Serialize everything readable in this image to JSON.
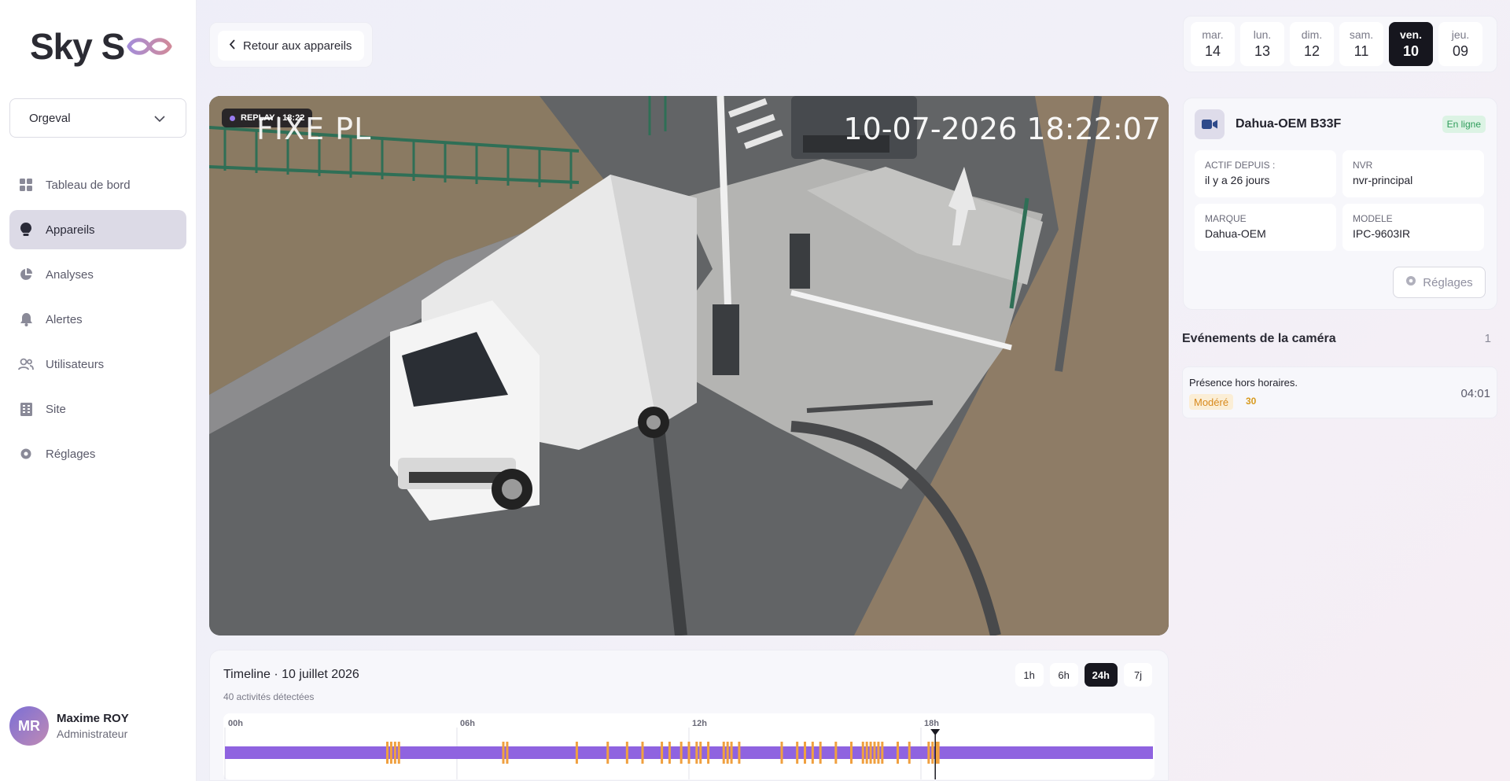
{
  "brand": {
    "logo_text": "Sky S",
    "accent": "#7b6fd6"
  },
  "sidebar": {
    "site_select": "Orgeval",
    "items": [
      {
        "label": "Tableau de bord",
        "icon": "grid-icon",
        "active": false
      },
      {
        "label": "Appareils",
        "icon": "lightbulb-icon",
        "active": true
      },
      {
        "label": "Analyses",
        "icon": "pie-chart-icon",
        "active": false
      },
      {
        "label": "Alertes",
        "icon": "bell-icon",
        "active": false
      },
      {
        "label": "Utilisateurs",
        "icon": "users-icon",
        "active": false
      },
      {
        "label": "Site",
        "icon": "building-icon",
        "active": false
      },
      {
        "label": "Réglages",
        "icon": "gear-icon",
        "active": false
      }
    ],
    "user": {
      "initials": "MR",
      "name": "Maxime ROY",
      "role": "Administrateur"
    }
  },
  "header": {
    "back_label": "Retour aux appareils"
  },
  "video": {
    "replay_badge": "REPLAY · 18:22",
    "camera_overlay_label": "FIXE PL",
    "camera_overlay_time": "10-07-2026 18:22:07"
  },
  "timeline": {
    "title": "Timeline · 10 juillet 2026",
    "subtitle": "40 activités détectées",
    "ranges": [
      "1h",
      "6h",
      "24h",
      "7j"
    ],
    "active_range": "24h",
    "hour_labels": [
      "00h",
      "06h",
      "12h",
      "18h"
    ],
    "cursor_hour": 18.37,
    "event_hours": [
      4.2,
      4.3,
      4.4,
      4.5,
      7.2,
      7.3,
      9.1,
      9.9,
      10.4,
      10.8,
      11.3,
      11.5,
      11.8,
      12.0,
      12.2,
      12.3,
      12.5,
      12.9,
      13.0,
      13.1,
      13.3,
      14.4,
      14.8,
      15.0,
      15.2,
      15.4,
      15.8,
      16.2,
      16.5,
      16.6,
      16.7,
      16.8,
      16.9,
      17.0,
      17.4,
      17.7,
      18.2,
      18.3,
      18.4,
      18.45
    ]
  },
  "days": [
    {
      "name": "mar.",
      "num": "14",
      "active": false
    },
    {
      "name": "lun.",
      "num": "13",
      "active": false
    },
    {
      "name": "dim.",
      "num": "12",
      "active": false
    },
    {
      "name": "sam.",
      "num": "11",
      "active": false
    },
    {
      "name": "ven.",
      "num": "10",
      "active": true
    },
    {
      "name": "jeu.",
      "num": "09",
      "active": false
    }
  ],
  "camera": {
    "name": "Dahua-OEM B33F",
    "status": "En ligne",
    "status_color": "#2e9c5a",
    "fields": [
      {
        "label": "Actif depuis :",
        "value": "il y a 26 jours"
      },
      {
        "label": "NVR",
        "value": "nvr-principal"
      },
      {
        "label": "Marque",
        "value": "Dahua-OEM"
      },
      {
        "label": "Modele",
        "value": "IPC-9603IR"
      }
    ],
    "settings_label": "Réglages"
  },
  "events": {
    "title": "Evénements de la caméra",
    "count": "1",
    "items": [
      {
        "title": "Présence hors horaires.",
        "severity": "Modéré",
        "score": "30",
        "time": "04:01"
      }
    ]
  },
  "colors": {
    "timeline_bar": "#8f63e0",
    "event_mark": "#f0a040",
    "selected": "#16161e"
  }
}
